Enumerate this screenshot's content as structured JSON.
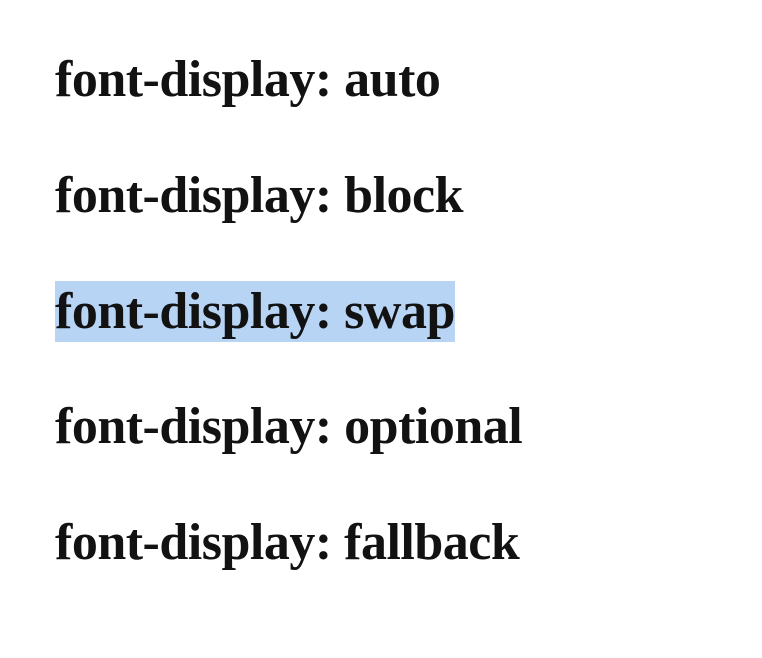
{
  "items": [
    {
      "text": "font-display: auto",
      "highlighted": false
    },
    {
      "text": "font-display: block",
      "highlighted": false
    },
    {
      "text": "font-display: swap",
      "highlighted": true
    },
    {
      "text": "font-display: optional",
      "highlighted": false
    },
    {
      "text": "font-display: fallback",
      "highlighted": false
    }
  ]
}
